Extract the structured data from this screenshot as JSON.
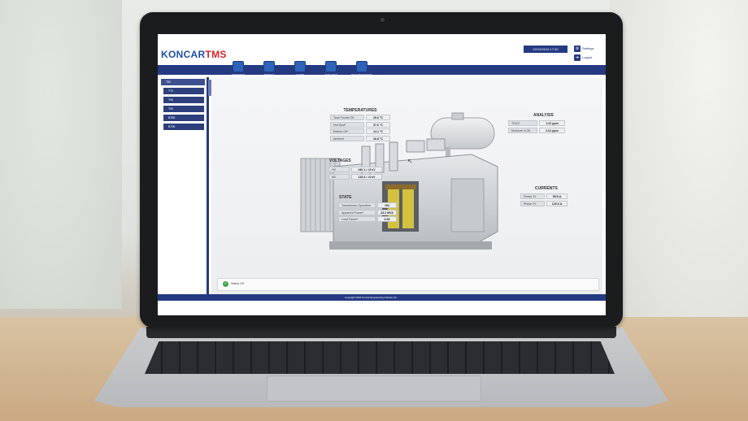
{
  "app": {
    "logo_part1": "KONCAR",
    "logo_part2": "TMS",
    "datetime": "22/12/2015 17:40",
    "settings_label": "Settings",
    "logout_label": "Logout"
  },
  "nav": [
    {
      "label": "OVERVIEW",
      "icon": "overview-icon"
    },
    {
      "label": "MODELS",
      "icon": "models-icon"
    },
    {
      "label": "FLOWS",
      "icon": "flows-icon"
    },
    {
      "label": "ANALYSES",
      "icon": "analyses-icon"
    },
    {
      "label": "DOCUMENTATION",
      "icon": "documentation-icon"
    }
  ],
  "sidebar": {
    "main": "T80",
    "items": [
      "T70",
      "T90",
      "T90",
      "BT80",
      "BT90"
    ]
  },
  "temperatures": {
    "title": "TEMPERATURES",
    "rows": [
      {
        "label": "Tank Pocket Oil",
        "value": "29.6 °C"
      },
      {
        "label": "Hot Spot*",
        "value": "37.6 °C"
      },
      {
        "label": "Bottom Oil*",
        "value": "14.1 °C"
      },
      {
        "label": "Ambient",
        "value": "16.8 °C"
      }
    ]
  },
  "voltages": {
    "title": "VOLTAGES",
    "rows": [
      {
        "label": "HV",
        "value": "240.1 / √3 kV"
      },
      {
        "label": "MV",
        "value": "115.4 / √3 kV"
      }
    ]
  },
  "state": {
    "title": "STATE",
    "rows": [
      {
        "label": "Transformer Operation",
        "value": "ON"
      },
      {
        "label": "Apparent Power*",
        "value": "23.2 MVA"
      },
      {
        "label": "Load Factor*",
        "value": "0.06"
      }
    ]
  },
  "analysis": {
    "title": "ANALYSIS",
    "rows": [
      {
        "label": "TDCG",
        "value": "1.22 ppm"
      },
      {
        "label": "Moisture in Oil",
        "value": "2.01 ppm"
      }
    ]
  },
  "currents": {
    "title": "CURRENTS",
    "rows": [
      {
        "label": "Phase 1Y",
        "value": "55.5 A"
      },
      {
        "label": "Phase 2Y",
        "value": "120.0 A"
      }
    ]
  },
  "status": {
    "text": "Status OK"
  },
  "footer": {
    "text": "Copyright 2016 Koncar-Engineering Institute Inc"
  }
}
